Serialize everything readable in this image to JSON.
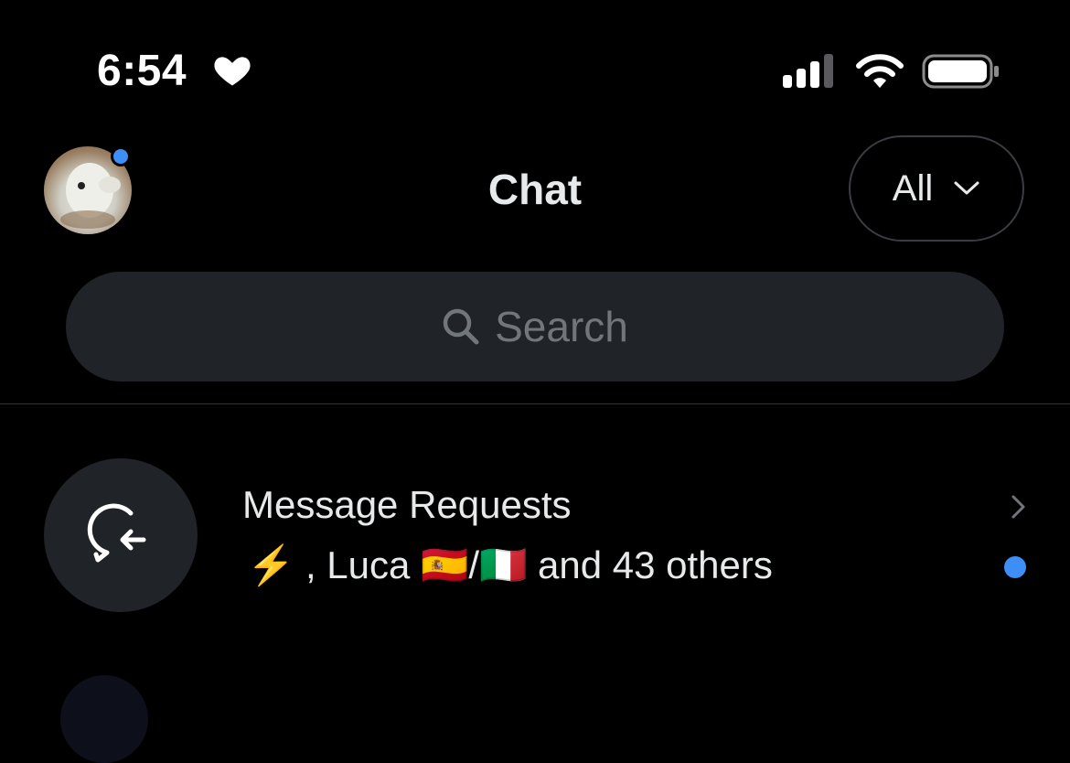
{
  "status_bar": {
    "time": "6:54",
    "heart_icon": "heart-icon",
    "signal_icon": "cellular-signal-icon",
    "wifi_icon": "wifi-icon",
    "battery_icon": "battery-icon"
  },
  "header": {
    "title": "Chat",
    "filter_label": "All",
    "filter_icon": "chevron-down-icon",
    "avatar_has_notification": true,
    "notification_color": "#3e8ef7"
  },
  "search": {
    "placeholder": "Search",
    "icon": "search-icon"
  },
  "message_requests": {
    "title": "Message Requests",
    "subtitle": "⚡️ , Luca 🇪🇸/🇮🇹 and 43 others",
    "icon": "message-request-icon",
    "unread": true
  },
  "colors": {
    "background": "#000000",
    "accent": "#3e8ef7",
    "surface": "#202327",
    "text_primary": "#e7e9ea",
    "text_secondary": "#71767b"
  }
}
